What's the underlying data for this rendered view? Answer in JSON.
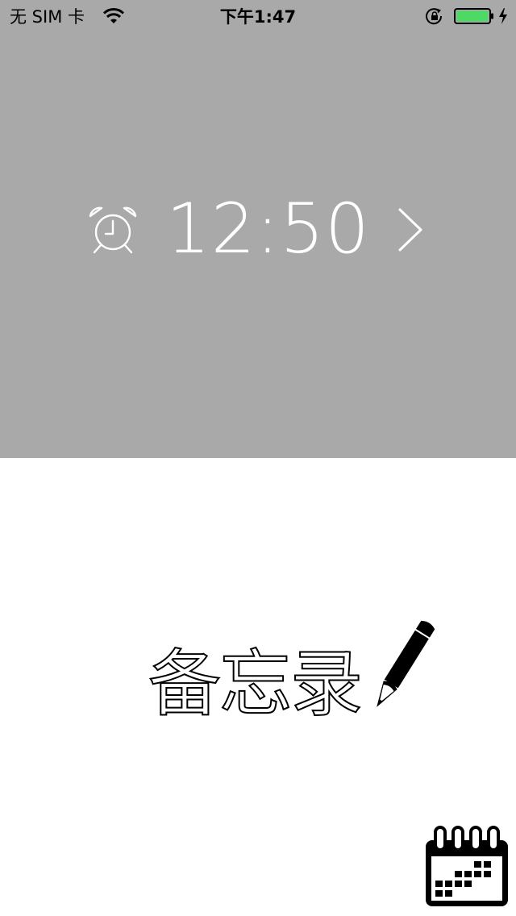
{
  "status_bar": {
    "carrier": "无 SIM 卡",
    "time": "下午1:47",
    "battery_color": "#4cd964"
  },
  "alarm": {
    "time": "12:50",
    "panel_color": "#a9a9a9",
    "icons": {
      "clock": "alarm-clock-icon",
      "next": "chevron-right-icon"
    }
  },
  "memo": {
    "title": "备忘录",
    "icon": "pencil-icon"
  },
  "calendar": {
    "icon": "calendar-icon"
  }
}
